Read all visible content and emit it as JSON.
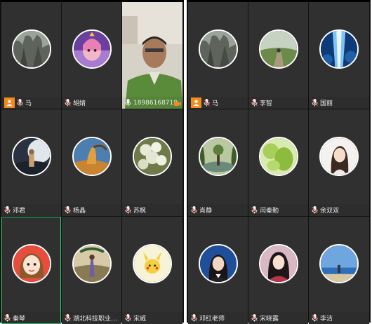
{
  "left_panel": {
    "tiles": [
      {
        "name": "马",
        "host": true
      },
      {
        "name": "胡婧"
      },
      {
        "name": "18986168719",
        "video": true
      },
      {
        "name": "邓君"
      },
      {
        "name": "杨晶"
      },
      {
        "name": "苏枫"
      },
      {
        "name": "秦琴"
      },
      {
        "name": "湖北科技职业学..."
      },
      {
        "name": "宋威"
      }
    ]
  },
  "right_panel": {
    "tiles": [
      {
        "name": "马",
        "host": true
      },
      {
        "name": "李智"
      },
      {
        "name": "国丽"
      },
      {
        "name": "肖静"
      },
      {
        "name": "闫秦勤"
      },
      {
        "name": "余双双"
      },
      {
        "name": "邓红老师"
      },
      {
        "name": "宋晓露"
      },
      {
        "name": "李洁"
      }
    ]
  },
  "colors": {
    "tile_bg": "#303031",
    "host_badge": "#f28a1e",
    "mic": "#f0f0f0",
    "selected_border": "#2ecc71"
  },
  "icons": [
    "mic-icon",
    "host-person-icon",
    "camera-icon"
  ]
}
